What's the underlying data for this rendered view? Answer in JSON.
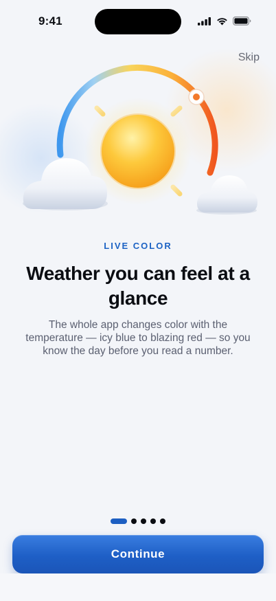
{
  "status_bar": {
    "time": "9:41",
    "icons": [
      "cellular-signal-icon",
      "wifi-icon",
      "battery-icon"
    ]
  },
  "onboarding": {
    "skip_label": "Skip",
    "eyebrow": "LIVE COLOR",
    "headline": "Weather you can feel at a glance",
    "body": "The whole app changes color with the temperature — icy blue to blazing red — so you know the day before you read a number.",
    "page_count": 5,
    "current_page": 1,
    "continue_label": "Continue"
  },
  "hero": {
    "icons": [
      "temperature-arc-icon",
      "sun-icon",
      "cloud-icon"
    ],
    "gradient_colors": [
      "#3e97ee",
      "#9fd0f2",
      "#f8d45c",
      "#fbb13a",
      "#f0561f"
    ]
  },
  "colors": {
    "accent": "#1d63c4",
    "button": "#1e5fc6",
    "background": "#f3f5f9",
    "sun": "#fbb02c"
  }
}
